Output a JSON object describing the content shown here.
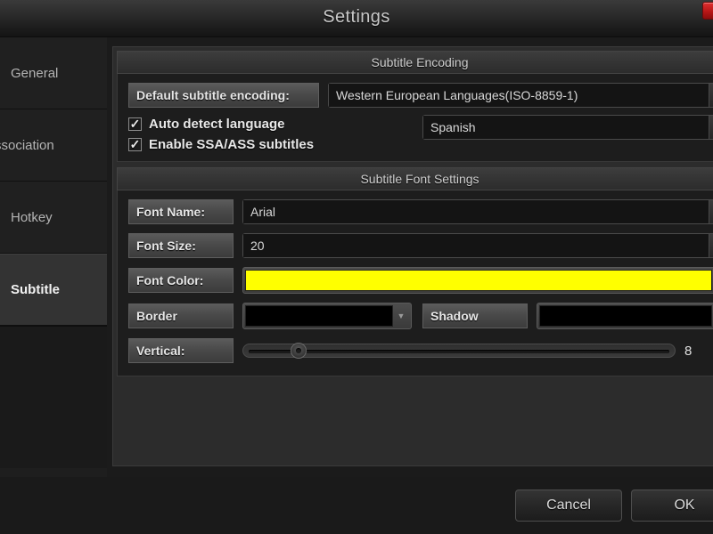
{
  "window": {
    "title": "Settings",
    "close_icon": "close-icon"
  },
  "sidebar": {
    "items": [
      {
        "label": "General",
        "selected": false
      },
      {
        "label": "Association",
        "selected": false
      },
      {
        "label": "Hotkey",
        "selected": false
      },
      {
        "label": "Subtitle",
        "selected": true
      }
    ]
  },
  "encoding_group": {
    "header": "Subtitle Encoding",
    "default_encoding_label": "Default subtitle encoding:",
    "default_encoding_value": "Western European Languages(ISO-8859-1)",
    "auto_detect_label": "Auto detect language",
    "auto_detect_checked": "✓",
    "enable_ssa_label": "Enable SSA/ASS subtitles",
    "enable_ssa_checked": "✓",
    "language_value": "Spanish",
    "dropdown_icon": "▼"
  },
  "font_group": {
    "header": "Subtitle Font Settings",
    "font_name_label": "Font Name:",
    "font_name_value": "Arial",
    "font_size_label": "Font Size:",
    "font_size_value": "20",
    "font_color_label": "Font Color:",
    "font_color_value": "#FFFF00",
    "border_label": "Border",
    "border_color_value": "#000000",
    "shadow_label": "Shadow",
    "shadow_color_value": "#000000",
    "vertical_label": "Vertical:",
    "vertical_value": "8",
    "vertical_percent": 11,
    "dropdown_icon": "▼"
  },
  "footer": {
    "cancel_label": "Cancel",
    "ok_label": "OK"
  },
  "colors": {
    "accent_yellow": "#FFFF00",
    "close_red": "#B81717",
    "panel_bg": "#2C2C2C"
  }
}
